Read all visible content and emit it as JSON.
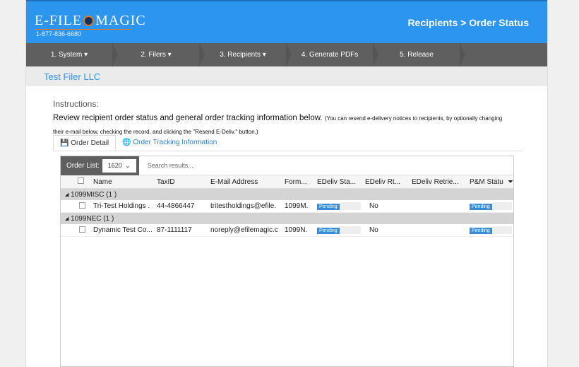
{
  "header": {
    "logo": "E-FILE MAGIC",
    "phone": "1-877-836-6680",
    "title": "Recipients > Order Status"
  },
  "nav": [
    "1. System",
    "2. Filers",
    "3. Recipients",
    "4. Generate PDFs",
    "5. Release"
  ],
  "filer": "Test Filer LLC",
  "instructions": {
    "title": "Instructions:",
    "main": "Review recipient order status and general order tracking information below.",
    "note": "(You can resend e-delivery notices to recipients, by optionally changing their e-mail below, checking the record, and clicking the \"Resend E-Deliv.\" button.)"
  },
  "tabs": [
    "Order Detail",
    "Order Tracking Information"
  ],
  "grid": {
    "order_list_label": "Order List:",
    "order_list_value": "1620",
    "search_placeholder": "Search results...",
    "columns": [
      "Name",
      "TaxID",
      "E-Mail Address",
      "Form...",
      "EDeliv Sta...",
      "EDeliv Rt...",
      "EDeliv Retrie...",
      "P&M Statu"
    ],
    "groups": [
      {
        "label": "1099MISC (1 )",
        "rows": [
          {
            "name": "Tri-Test Holdings .",
            "taxid": "44-4866447",
            "email": "tritestholdings@efile.",
            "form": "1099M.",
            "edeliv_status": "Pending",
            "edeliv_rt": "No",
            "edeliv_retrieved": "",
            "pm_status": "Pending"
          }
        ]
      },
      {
        "label": "1099NEC (1 )",
        "rows": [
          {
            "name": "Dynamic Test Co...",
            "taxid": "87-1111117",
            "email": "noreply@efilemagic.c",
            "form": "1099N.",
            "edeliv_status": "Pending",
            "edeliv_rt": "No",
            "edeliv_retrieved": "",
            "pm_status": "Pending"
          }
        ]
      }
    ]
  }
}
